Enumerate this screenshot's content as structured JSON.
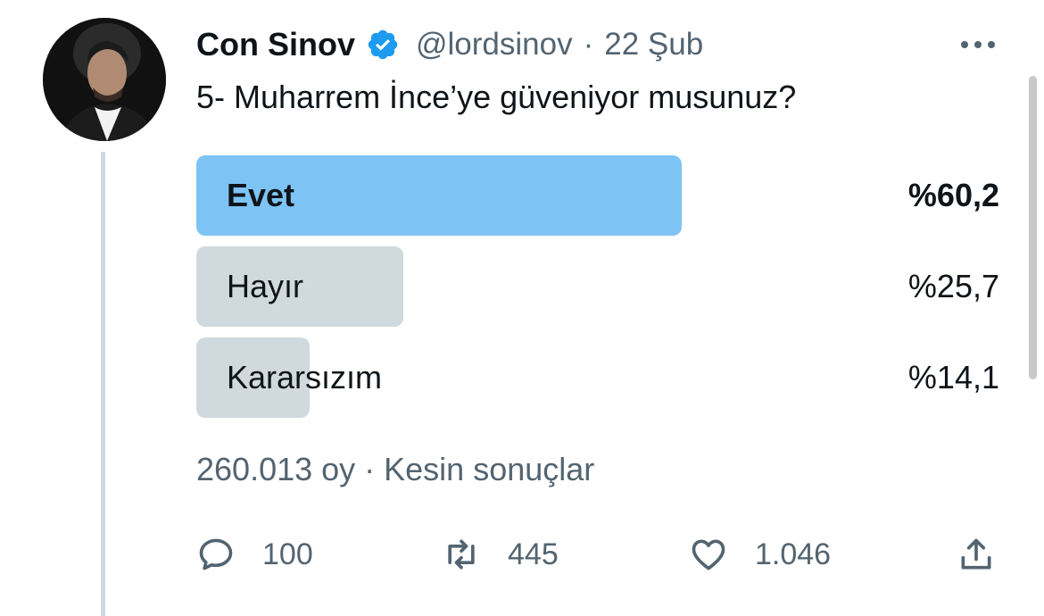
{
  "tweet": {
    "author_name": "Con Sinov",
    "handle": "@lordsinov",
    "separator": "·",
    "date": "22 Şub",
    "text": "5- Muharrem İnce’ye güveniyor musunuz?"
  },
  "poll": {
    "options": [
      {
        "label": "Evet",
        "percent_text": "%60,2",
        "percent": 60.2,
        "winner": true
      },
      {
        "label": "Hayır",
        "percent_text": "%25,7",
        "percent": 25.7,
        "winner": false
      },
      {
        "label": "Kararsızım",
        "percent_text": "%14,1",
        "percent": 14.1,
        "winner": false
      }
    ],
    "footer": "260.013 oy · Kesin sonuçlar"
  },
  "actions": {
    "replies": "100",
    "retweets": "445",
    "likes": "1.046"
  },
  "colors": {
    "winner_bar": "#7dc4f5",
    "other_bar": "#cfd9de",
    "verified": "#1d9bf0",
    "secondary_text": "#536471"
  },
  "icons": {
    "verified": "verified-badge-icon",
    "more": "more-dots-icon",
    "reply": "reply-icon",
    "retweet": "retweet-icon",
    "like": "heart-icon",
    "share": "share-icon"
  }
}
